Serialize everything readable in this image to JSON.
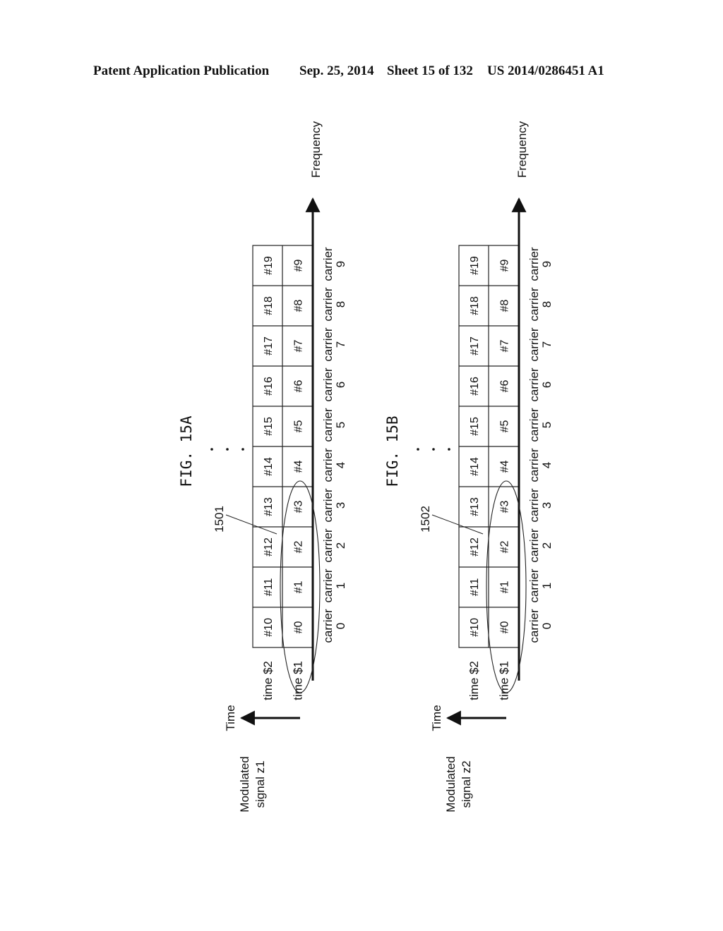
{
  "header": {
    "title": "Patent Application Publication",
    "date": "Sep. 25, 2014",
    "sheet": "Sheet 15 of 132",
    "pub_number": "US 2014/0286451 A1"
  },
  "figures": [
    {
      "id": "a",
      "fig_label": "FIG. 15A",
      "signal_label_line1": "Modulated",
      "signal_label_line2": "signal z1",
      "time_axis_label": "Time",
      "frequency_axis_label": "Frequency",
      "reference_numeral": "1501",
      "ellipsis": "...",
      "row_labels": [
        "time $2",
        "time $1"
      ],
      "rows": [
        [
          "#10",
          "#11",
          "#12",
          "#13",
          "#14",
          "#15",
          "#16",
          "#17",
          "#18",
          "#19"
        ],
        [
          "#0",
          "#1",
          "#2",
          "#3",
          "#4",
          "#5",
          "#6",
          "#7",
          "#8",
          "#9"
        ]
      ],
      "carrier_word": "carrier",
      "carriers": [
        "0",
        "1",
        "2",
        "3",
        "4",
        "5",
        "6",
        "7",
        "8",
        "9"
      ]
    },
    {
      "id": "b",
      "fig_label": "FIG. 15B",
      "signal_label_line1": "Modulated",
      "signal_label_line2": "signal z2",
      "time_axis_label": "Time",
      "frequency_axis_label": "Frequency",
      "reference_numeral": "1502",
      "ellipsis": "...",
      "row_labels": [
        "time $2",
        "time $1"
      ],
      "rows": [
        [
          "#10",
          "#11",
          "#12",
          "#13",
          "#14",
          "#15",
          "#16",
          "#17",
          "#18",
          "#19"
        ],
        [
          "#0",
          "#1",
          "#2",
          "#3",
          "#4",
          "#5",
          "#6",
          "#7",
          "#8",
          "#9"
        ]
      ],
      "carrier_word": "carrier",
      "carriers": [
        "0",
        "1",
        "2",
        "3",
        "4",
        "5",
        "6",
        "7",
        "8",
        "9"
      ]
    }
  ]
}
